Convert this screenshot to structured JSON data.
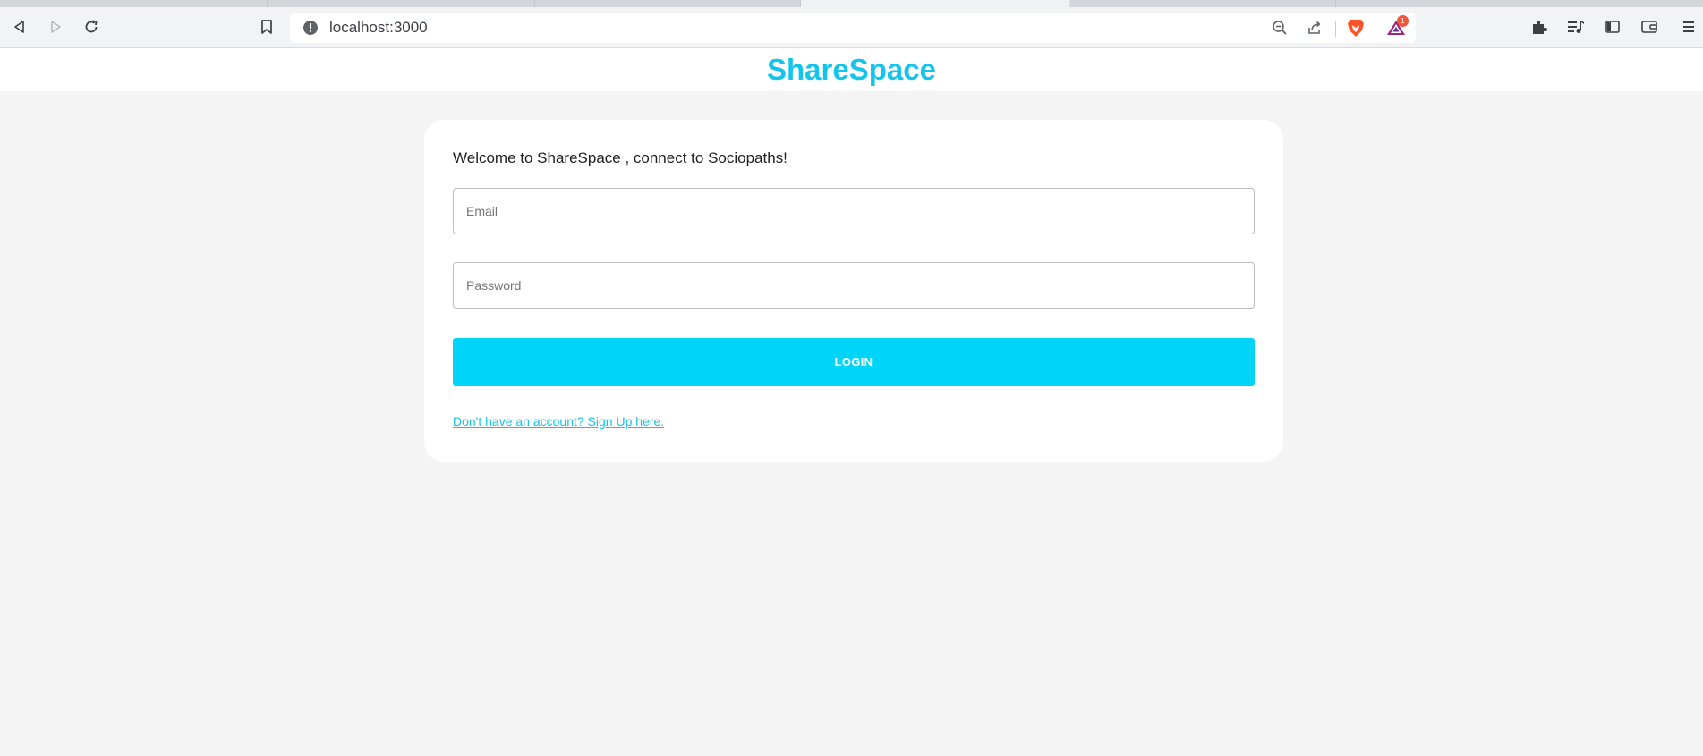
{
  "browser": {
    "url": "localhost:3000",
    "wallet_badge_count": "1",
    "icons": {
      "back": "back-arrow-icon",
      "forward": "forward-arrow-icon",
      "reload": "reload-icon",
      "bookmark": "bookmark-icon",
      "site_info": "info-icon",
      "zoom": "zoom-out-icon",
      "share": "share-icon",
      "brave_shields": "brave-lion-icon",
      "brave_rewards": "brave-rewards-triangle-icon",
      "extensions": "puzzle-piece-icon",
      "media": "media-playlist-icon",
      "sidebar": "sidebar-icon",
      "wallet": "wallet-icon",
      "menu": "menu-icon"
    }
  },
  "header": {
    "brand": "ShareSpace"
  },
  "login": {
    "welcome_text": "Welcome to ShareSpace , connect to Sociopaths!",
    "email_placeholder": "Email",
    "password_placeholder": "Password",
    "submit_label": "LOGIN",
    "signup_link": "Don't have an account? Sign Up here."
  },
  "colors": {
    "brand": "#13c5ea",
    "button": "#00d4f8",
    "page_background": "#f4f4f4"
  }
}
